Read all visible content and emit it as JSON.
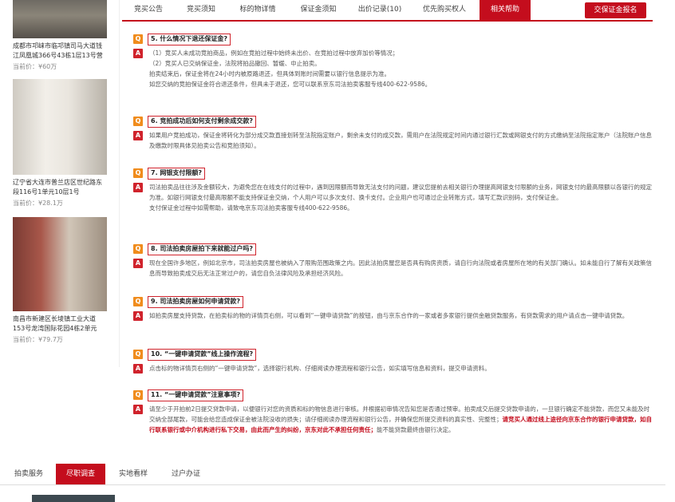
{
  "sidebar": {
    "price_label": "当前价：",
    "items": [
      {
        "title": "成都市邛崃市临邛镇司马大道钱江凤凰城366号43栋1层13号营",
        "price": "¥60万"
      },
      {
        "title": "辽宁省大连市普兰店区世纪路东段116号1单元10层1号",
        "price": "¥28.1万"
      },
      {
        "title": "南昌市新建区长堎镇工业大道153号龙湾国际花园4栋2单元",
        "price": "¥79.7万"
      }
    ]
  },
  "tabs": [
    {
      "label": "竞买公告"
    },
    {
      "label": "竞买须知"
    },
    {
      "label": "标的物详情"
    },
    {
      "label": "保证金须知"
    },
    {
      "label": "出价记录(10)"
    },
    {
      "label": "优先购买权人"
    },
    {
      "label": "相关帮助"
    }
  ],
  "deposit_button": "交保证金报名",
  "q_badge": "Q",
  "a_badge": "A",
  "faq": [
    {
      "q": "5. 什么情况下退还保证金?",
      "a": [
        "（1）竞买人未成功竞拍商品，例如在竞拍过程中始终未出价、在竞拍过程中放弃加价等情况；",
        "（2）竞买人已交纳保证金，法院将拍品撤回、暂缓、中止拍卖。",
        "拍卖结束后，保证金将在24小时内被原路退还，但具体到账时间需要以银行信息提示为准。",
        "如您交纳的竞拍保证金符合退还条件，但具未于退还，您可以联系京东司法拍卖客服专线400-622-9586。"
      ]
    },
    {
      "q": "6. 竞拍成功后如何支付剩余成交款?",
      "a": [
        "如果用户竞拍成功，保证金将转化为部分成交款直接划转至法院指定账户，剩余未支付的成交款，需用户在法院规定时间内通过银行汇款或网银支付的方式缴纳至法院指定账户（法院账户信息及缴款时限具体见拍卖公告和竞拍须知）。"
      ]
    },
    {
      "q": "7. 网银支付限额?",
      "a": [
        "司法拍卖品往往涉及金额较大，为避免您在在线支付的过程中，遇到因限额而导致无法支付的问题，建议您提前去相关银行办理提高网银支付限额的业务，网银支付的最高限额以各银行的规定为准。如银行网银支付最高限额不能支持保证金交纳，个人用户可以多次支付、换卡支付。企业用户也可通过企业转账方式，填写汇款识别码，支付保证金。",
        "支付保证金过程中如需帮助，请致电京东司法拍卖客服专线400-622-9586。"
      ]
    },
    {
      "q": "8. 司法拍卖房屋拍下来就能过户吗?",
      "a": [
        "现在全国许多地区，例如北京市，司法拍卖房屋也被纳入了限购范围政策之内。因此法拍房屋您是否具有购房资质，请自行向法院或者房屋所在地的有关部门确认。如未能自行了解有关政策信息而导致拍卖成交后无法正常过户的，请您自负法律风险及承担经济风险。"
      ]
    },
    {
      "q": "9. 司法拍卖房屋如何申请贷款?",
      "a": [
        "如拍卖房屋支持贷款，在拍卖标的物的详情页右侧，可以看到“一键申请贷款”的按钮，由与京东合作的一家或者多家银行提供金融贷款服务，有贷款需求的用户请点击一键申请贷款。"
      ]
    },
    {
      "q": "10. “一键申请贷款”线上操作流程?",
      "a": [
        "点击标的物详情页右侧的“一键申请贷款”，选择银行机构、仔细阅读办理流程和银行公告，如实填写信息和资料，提交申请资料。"
      ]
    },
    {
      "q": "11. “一键申请贷款”注意事项?",
      "a_parts": [
        "请至少于开拍前2日提交贷款申请，以便银行对您的资质和标的物信息进行审核。并根据初审情况告知您是否通过预审。拍卖成交后提交贷款申请的，一旦银行确定不能贷款，而您又未能及时交纳全部尾款，可能会给您造成保证金被法院没收的损失；请仔细阅读办理流程和银行公告，并确保您所提交资料的真实性、完整性；",
        "请竞买人通过线上途径向京东合作的银行申请贷款，如自行联系银行或中介机构进行私下交易，由此而产生的纠纷，京东对此不承担任何责任；",
        "能不能贷款最终由银行决定。"
      ]
    }
  ],
  "bottom_tabs": [
    {
      "label": "拍卖服务"
    },
    {
      "label": "尽职调查"
    },
    {
      "label": "实地看样"
    },
    {
      "label": "过户办证"
    }
  ],
  "colors": {
    "accent": "#c40d1d",
    "q_badge": "#f08c1d",
    "a_badge": "#d0232c"
  }
}
